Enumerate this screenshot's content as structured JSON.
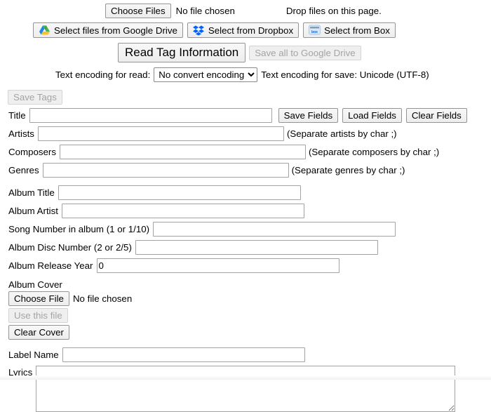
{
  "file_row": {
    "choose_files_label": "Choose Files",
    "no_file_chosen": "No file chosen",
    "drop_message": "Drop files on this page."
  },
  "cloud_row": {
    "google_drive_label": "Select files from Google Drive",
    "google_drive_icon": "google-drive-icon",
    "dropbox_label": "Select from Dropbox",
    "dropbox_icon": "dropbox-icon",
    "box_label": "Select from Box",
    "box_icon": "box-icon"
  },
  "read_row": {
    "read_tag_label": "Read Tag Information",
    "save_all_label": "Save all to Google Drive",
    "save_all_disabled": true
  },
  "encoding_row": {
    "read_label": "Text encoding for read:",
    "read_selected": "No convert encoding",
    "read_options": [
      "No convert encoding"
    ],
    "save_label": "Text encoding for save: Unicode (UTF-8)"
  },
  "save_tags": {
    "label": "Save Tags",
    "disabled": true
  },
  "fields": {
    "title": {
      "label": "Title",
      "value": "",
      "placeholder": ""
    },
    "artists": {
      "label": "Artists",
      "value": "",
      "hint": "(Separate artists by char ;)"
    },
    "composers": {
      "label": "Composers",
      "value": "",
      "hint": "(Separate composers by char ;)"
    },
    "genres": {
      "label": "Genres",
      "value": "",
      "hint": "(Separate genres by char ;)"
    },
    "album_title": {
      "label": "Album Title",
      "value": ""
    },
    "album_artist": {
      "label": "Album Artist",
      "value": ""
    },
    "song_number": {
      "label": "Song Number in album (1 or 1/10)",
      "value": ""
    },
    "disc_number": {
      "label": "Album Disc Number (2 or 2/5)",
      "value": ""
    },
    "release_year": {
      "label": "Album Release Year",
      "value": "0"
    },
    "label_name": {
      "label": "Label Name",
      "value": ""
    },
    "lyrics": {
      "label": "Lyrics",
      "value": ""
    }
  },
  "field_buttons": {
    "save_fields": "Save Fields",
    "load_fields": "Load Fields",
    "clear_fields": "Clear Fields"
  },
  "album_cover": {
    "heading": "Album Cover",
    "choose_file_label": "Choose File",
    "no_file_chosen": "No file chosen",
    "use_this_file_label": "Use this file",
    "use_this_file_disabled": true,
    "clear_cover_label": "Clear Cover"
  },
  "colors": {
    "text": "#000000",
    "disabled_text": "#a4a4a4",
    "input_border": "#a2a2a2",
    "button_border": "#949494",
    "dropbox_blue": "#0061ff",
    "box_blue": "#0061d5"
  }
}
